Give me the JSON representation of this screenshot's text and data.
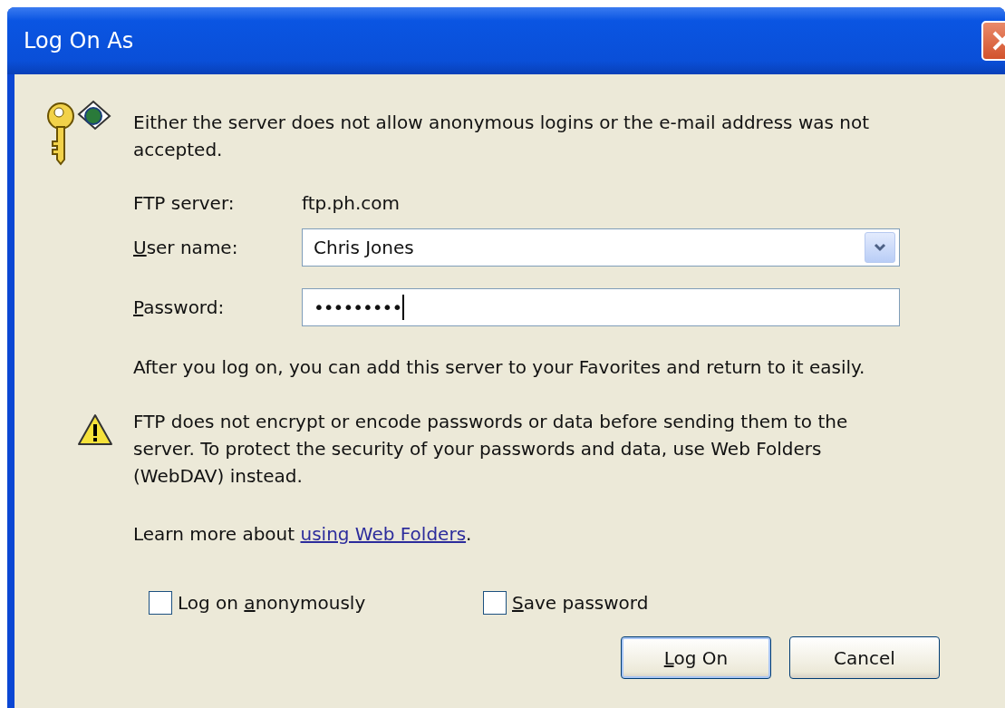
{
  "window": {
    "title": "Log On As"
  },
  "message": "Either the server does not allow anonymous logins or the e-mail address was not accepted.",
  "server": {
    "label": "FTP server:",
    "value": "ftp.ph.com"
  },
  "fields": [
    {
      "kind": "combo",
      "label_key": "U",
      "label_post": "ser name:",
      "value": "Chris Jones"
    },
    {
      "kind": "password",
      "label_key": "P",
      "label_post": "assword:",
      "value": "•••••••••"
    }
  ],
  "favorites_note": "After you log on, you can add this server to your Favorites and return to it easily.",
  "warning": "FTP does not encrypt or encode passwords or data before sending them to the server.  To protect the security of your passwords and data, use Web Folders (WebDAV) instead.",
  "learn_more": {
    "text": "Learn more about",
    "link": "using Web Folders",
    "after": "."
  },
  "checkboxes": [
    {
      "label_pre": "Log on ",
      "label_key": "a",
      "label_post": "nonymously",
      "checked": false
    },
    {
      "label_key": "S",
      "label_post": "ave password",
      "checked": false
    }
  ],
  "buttons": [
    {
      "label_key": "L",
      "label_post": "og On",
      "default": true
    },
    {
      "label_pre": "Cancel",
      "default": false
    }
  ]
}
